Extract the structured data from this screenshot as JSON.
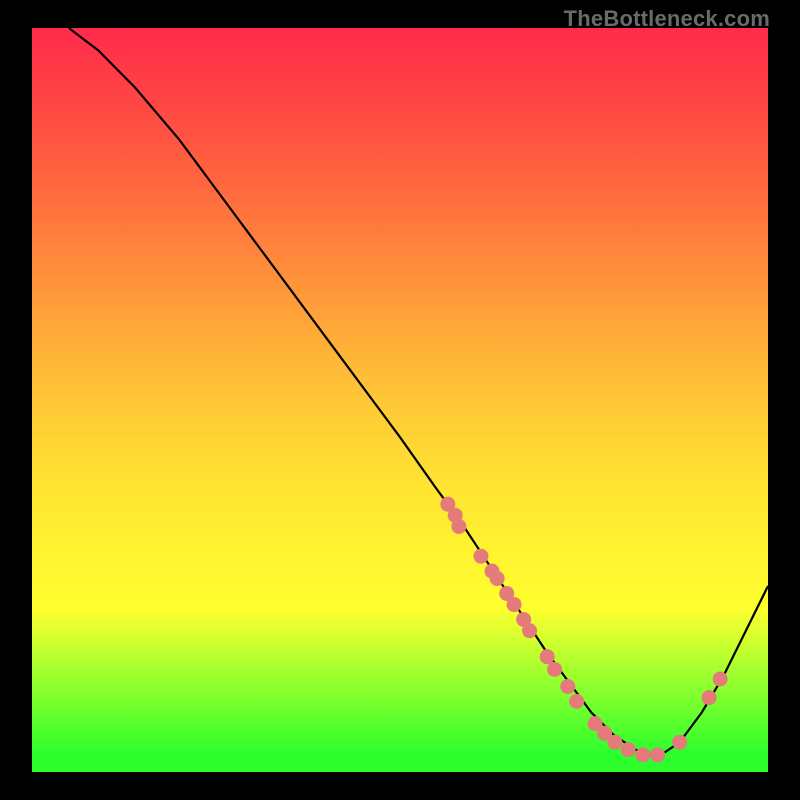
{
  "watermark": "TheBottleneck.com",
  "colors": {
    "frame_border": "#000000",
    "curve": "#000000",
    "marker": "#e47a7a",
    "gradient_top": "#ff2b4c",
    "gradient_bottom": "#2dff2d"
  },
  "chart_data": {
    "type": "line",
    "title": "",
    "xlabel": "",
    "ylabel": "",
    "xlim": [
      0,
      100
    ],
    "ylim": [
      0,
      100
    ],
    "curve": {
      "x": [
        5,
        9,
        14,
        20,
        26,
        32,
        38,
        44,
        50,
        55,
        58,
        62,
        66,
        70,
        73,
        76,
        79,
        82,
        85,
        88,
        91,
        94,
        97,
        100
      ],
      "y": [
        100,
        97,
        92,
        85,
        77,
        69,
        61,
        53,
        45,
        38,
        34,
        28,
        22,
        16,
        12,
        8,
        5,
        3,
        2,
        4,
        8,
        13,
        19,
        25
      ]
    },
    "markers": [
      {
        "x": 56.5,
        "y": 36.0
      },
      {
        "x": 57.5,
        "y": 34.5
      },
      {
        "x": 58.0,
        "y": 33.0
      },
      {
        "x": 61.0,
        "y": 29.0
      },
      {
        "x": 62.5,
        "y": 27.0
      },
      {
        "x": 63.2,
        "y": 26.0
      },
      {
        "x": 64.5,
        "y": 24.0
      },
      {
        "x": 65.5,
        "y": 22.5
      },
      {
        "x": 66.8,
        "y": 20.5
      },
      {
        "x": 67.6,
        "y": 19.0
      },
      {
        "x": 70.0,
        "y": 15.5
      },
      {
        "x": 71.0,
        "y": 13.8
      },
      {
        "x": 72.8,
        "y": 11.5
      },
      {
        "x": 74.0,
        "y": 9.5
      },
      {
        "x": 76.5,
        "y": 6.5
      },
      {
        "x": 77.8,
        "y": 5.2
      },
      {
        "x": 79.2,
        "y": 4.0
      },
      {
        "x": 81.0,
        "y": 3.0
      },
      {
        "x": 83.0,
        "y": 2.3
      },
      {
        "x": 85.0,
        "y": 2.3
      },
      {
        "x": 88.0,
        "y": 4.0
      },
      {
        "x": 92.0,
        "y": 10.0
      },
      {
        "x": 93.5,
        "y": 12.5
      }
    ],
    "marker_radius": 7.5
  }
}
